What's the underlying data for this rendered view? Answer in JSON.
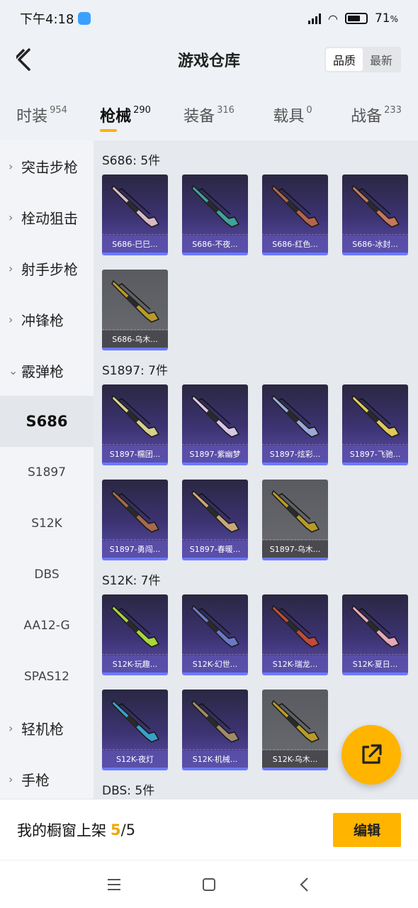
{
  "status": {
    "time": "下午4:18",
    "battery": "71",
    "battery_unit": "%",
    "battery_level": 0.71
  },
  "header": {
    "title": "游戏仓库",
    "sort": [
      "品质",
      "最新"
    ]
  },
  "tabs": [
    {
      "label": "时装",
      "count": "954"
    },
    {
      "label": "枪械",
      "count": "290"
    },
    {
      "label": "装备",
      "count": "316"
    },
    {
      "label": "载具",
      "count": "0"
    },
    {
      "label": "战备",
      "count": "233"
    }
  ],
  "sidebar": {
    "categories_top": [
      "突击步枪",
      "栓动狙击",
      "射手步枪",
      "冲锋枪"
    ],
    "expanded": "霰弹枪",
    "subs": [
      "S686",
      "S1897",
      "S12K",
      "DBS",
      "AA12-G",
      "SPAS12"
    ],
    "categories_bottom": [
      "轻机枪",
      "手枪"
    ]
  },
  "groups": [
    {
      "title": "S686: 5件",
      "items": [
        {
          "name": "S686-巳巳...",
          "color": "#d9b8c8",
          "grey": false
        },
        {
          "name": "S686-不夜...",
          "color": "#3fa39a",
          "grey": false
        },
        {
          "name": "S686-红色...",
          "color": "#b5644a",
          "grey": false
        },
        {
          "name": "S686-冰封...",
          "color": "#c7775a",
          "grey": false
        },
        {
          "name": "S686-乌木...",
          "color": "#b89a2a",
          "grey": true
        }
      ]
    },
    {
      "title": "S1897: 7件",
      "items": [
        {
          "name": "S1897-糯团...",
          "color": "#d8cf8c",
          "grey": false
        },
        {
          "name": "S1897-紫幽梦",
          "color": "#d8c6e6",
          "grey": false
        },
        {
          "name": "S1897-炫彩...",
          "color": "#9aa9d8",
          "grey": false
        },
        {
          "name": "S1897-飞驰...",
          "color": "#e0c85a",
          "grey": false
        },
        {
          "name": "S1897-勇闯...",
          "color": "#a56a4a",
          "grey": false
        },
        {
          "name": "S1897-春暖...",
          "color": "#c8a878",
          "grey": false
        },
        {
          "name": "S1897-乌木...",
          "color": "#b89a2a",
          "grey": true
        }
      ]
    },
    {
      "title": "S12K: 7件",
      "items": [
        {
          "name": "S12K-玩趣...",
          "color": "#a6d83a",
          "grey": false
        },
        {
          "name": "S12K-幻世...",
          "color": "#6a78c8",
          "grey": false
        },
        {
          "name": "S12K-瑞龙...",
          "color": "#c24a3a",
          "grey": false
        },
        {
          "name": "S12K-夏日...",
          "color": "#e6a8b8",
          "grey": false
        },
        {
          "name": "S12K-夜灯",
          "color": "#3aa0c8",
          "grey": false
        },
        {
          "name": "S12K-机械...",
          "color": "#a08a6a",
          "grey": false
        },
        {
          "name": "S12K-乌木...",
          "color": "#b89a2a",
          "grey": true
        }
      ]
    },
    {
      "title": "DBS: 5件",
      "items": []
    }
  ],
  "bottom": {
    "label": "我的橱窗上架",
    "current": "5",
    "total": "/5",
    "edit": "编辑"
  }
}
